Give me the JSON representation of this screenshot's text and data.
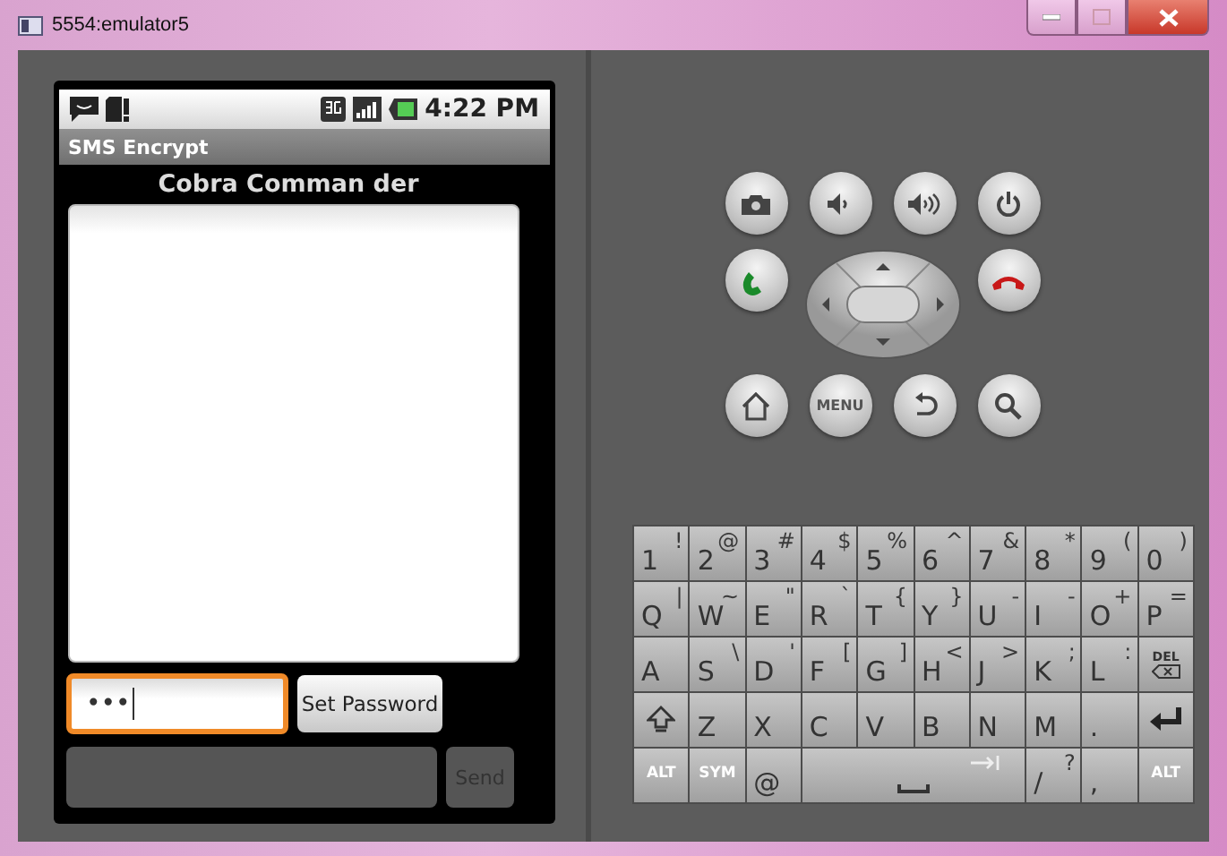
{
  "window": {
    "title": "5554:emulator5"
  },
  "status_bar": {
    "time": "4:22 PM"
  },
  "app": {
    "title": "SMS Encrypt",
    "heading": "Cobra Comman der",
    "password": {
      "value": "•••",
      "focused": true
    },
    "set_password_button": "Set Password",
    "send_button": {
      "label": "Send",
      "disabled": true
    }
  },
  "hardware_buttons": [
    {
      "kind": "camera"
    },
    {
      "kind": "volume-down"
    },
    {
      "kind": "volume-up"
    },
    {
      "kind": "power"
    },
    {
      "kind": "call"
    },
    {
      "kind": "dpad"
    },
    {
      "kind": "end-call"
    },
    {
      "kind": "home"
    },
    {
      "kind": "menu",
      "label": "MENU"
    },
    {
      "kind": "back"
    },
    {
      "kind": "search"
    }
  ],
  "keyboard": {
    "rows": [
      [
        {
          "kind": "char",
          "main": "1",
          "alt": "!"
        },
        {
          "kind": "char",
          "main": "2",
          "alt": "@"
        },
        {
          "kind": "char",
          "main": "3",
          "alt": "#"
        },
        {
          "kind": "char",
          "main": "4",
          "alt": "$"
        },
        {
          "kind": "char",
          "main": "5",
          "alt": "%"
        },
        {
          "kind": "char",
          "main": "6",
          "alt": "^"
        },
        {
          "kind": "char",
          "main": "7",
          "alt": "&"
        },
        {
          "kind": "char",
          "main": "8",
          "alt": "*"
        },
        {
          "kind": "char",
          "main": "9",
          "alt": "("
        },
        {
          "kind": "char",
          "main": "0",
          "alt": ")"
        }
      ],
      [
        {
          "kind": "char",
          "main": "Q",
          "alt": "|"
        },
        {
          "kind": "char",
          "main": "W",
          "alt": "~"
        },
        {
          "kind": "char",
          "main": "E",
          "alt": "\""
        },
        {
          "kind": "char",
          "main": "R",
          "alt": "`"
        },
        {
          "kind": "char",
          "main": "T",
          "alt": "{"
        },
        {
          "kind": "char",
          "main": "Y",
          "alt": "}"
        },
        {
          "kind": "char",
          "main": "U",
          "alt": "-"
        },
        {
          "kind": "char",
          "main": "I",
          "alt": "-"
        },
        {
          "kind": "char",
          "main": "O",
          "alt": "+"
        },
        {
          "kind": "char",
          "main": "P",
          "alt": "="
        }
      ],
      [
        {
          "kind": "char",
          "main": "A"
        },
        {
          "kind": "char",
          "main": "S",
          "alt": "\\"
        },
        {
          "kind": "char",
          "main": "D",
          "alt": "'"
        },
        {
          "kind": "char",
          "main": "F",
          "alt": "["
        },
        {
          "kind": "char",
          "main": "G",
          "alt": "]"
        },
        {
          "kind": "char",
          "main": "H",
          "alt": "<"
        },
        {
          "kind": "char",
          "main": "J",
          "alt": ">"
        },
        {
          "kind": "char",
          "main": "K",
          "alt": ";"
        },
        {
          "kind": "char",
          "main": "L",
          "alt": ":"
        },
        {
          "kind": "del",
          "main": "DEL"
        }
      ],
      [
        {
          "kind": "shift"
        },
        {
          "kind": "char",
          "main": "Z"
        },
        {
          "kind": "char",
          "main": "X"
        },
        {
          "kind": "char",
          "main": "C"
        },
        {
          "kind": "char",
          "main": "V"
        },
        {
          "kind": "char",
          "main": "B"
        },
        {
          "kind": "char",
          "main": "N"
        },
        {
          "kind": "char",
          "main": "M"
        },
        {
          "kind": "char",
          "main": "."
        },
        {
          "kind": "enter"
        }
      ]
    ],
    "bottom_row": [
      {
        "kind": "label",
        "main": "ALT"
      },
      {
        "kind": "label",
        "main": "SYM"
      },
      {
        "kind": "char",
        "main": "@"
      },
      {
        "kind": "space"
      },
      {
        "kind": "char",
        "main": "/",
        "alt": "?"
      },
      {
        "kind": "char",
        "main": ","
      },
      {
        "kind": "label",
        "main": "ALT"
      }
    ]
  }
}
